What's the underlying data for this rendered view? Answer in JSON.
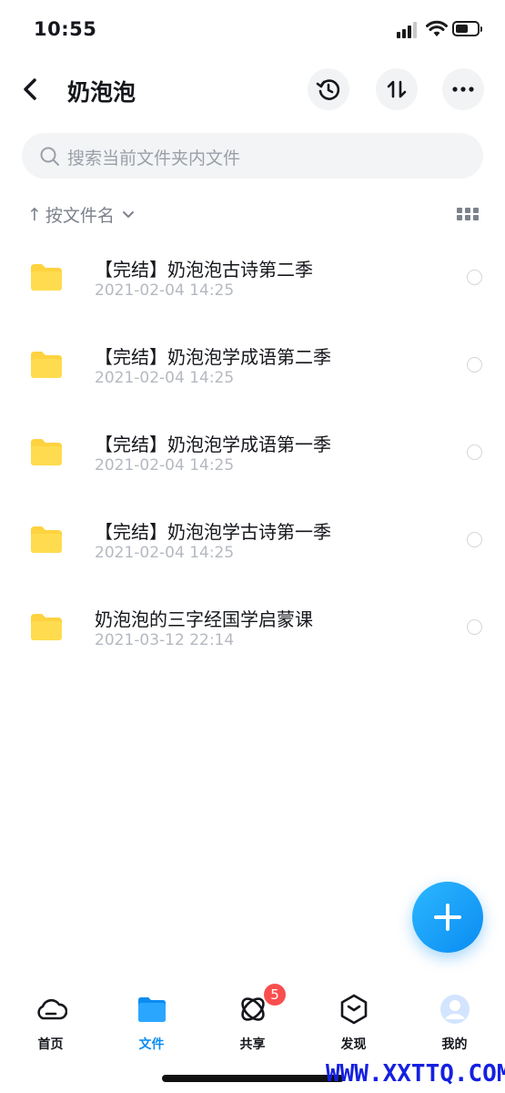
{
  "status_bar": {
    "time": "10:55"
  },
  "header": {
    "title": "奶泡泡"
  },
  "search": {
    "placeholder": "搜索当前文件夹内文件"
  },
  "sort": {
    "arrow": "↑",
    "label": "按文件名"
  },
  "files": [
    {
      "name": "【完结】奶泡泡古诗第二季",
      "date": "2021-02-04 14:25"
    },
    {
      "name": "【完结】奶泡泡学成语第二季",
      "date": "2021-02-04 14:25"
    },
    {
      "name": "【完结】奶泡泡学成语第一季",
      "date": "2021-02-04 14:25"
    },
    {
      "name": "【完结】奶泡泡学古诗第一季",
      "date": "2021-02-04 14:25"
    },
    {
      "name": "奶泡泡的三字经国学启蒙课",
      "date": "2021-03-12 22:14"
    }
  ],
  "tabs": [
    {
      "label": "首页",
      "icon": "cloud-home-icon"
    },
    {
      "label": "文件",
      "icon": "folder-icon",
      "active": true
    },
    {
      "label": "共享",
      "icon": "share-orbit-icon"
    },
    {
      "label": "发现",
      "icon": "discover-hexagon-icon"
    },
    {
      "label": "我的",
      "icon": "avatar-icon"
    }
  ],
  "share_badge": "5",
  "watermark": "WWW.XXTTQ.COM",
  "colors": {
    "accent": "#0a8cf2",
    "folder": "#ffd23f",
    "badge": "#fa4e4e",
    "watermark": "#1520e0"
  }
}
